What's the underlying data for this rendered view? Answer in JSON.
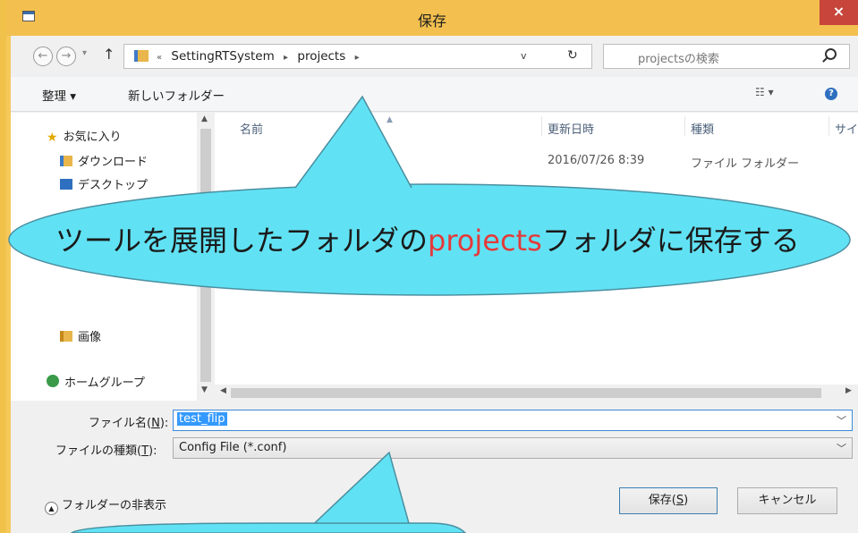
{
  "window": {
    "title": "保存",
    "close_glyph": "×"
  },
  "nav": {
    "back_glyph": "←",
    "forward_glyph": "→",
    "recent_glyph": "▾",
    "up_glyph": "↑",
    "breadcrumb": [
      "«",
      "SettingRTSystem",
      "▸",
      "projects",
      "▸"
    ],
    "address_dropdown_glyph": "v",
    "refresh_glyph": "↻",
    "search_placeholder": "projectsの検索"
  },
  "commands": {
    "organize": "整理 ▾",
    "new_folder": "新しいフォルダー",
    "view": "☷ ▾",
    "help": "?"
  },
  "sidebar": {
    "favorites": "お気に入り",
    "favorites_icon": "star-icon",
    "downloads": "ダウンロード",
    "desktop": "デスクトップ",
    "pictures": "画像",
    "homegroup": "ホームグループ"
  },
  "columns": {
    "name": "名前",
    "date": "更新日時",
    "type": "種類",
    "size": "サイズ"
  },
  "rows": [
    {
      "date": "2016/07/26 8:39",
      "type": "ファイル フォルダー"
    }
  ],
  "form": {
    "file_name_label_pre": "ファイル名(",
    "file_name_label_key": "N",
    "file_name_label_post": "):",
    "file_name_value": "test_flip",
    "file_type_label_pre": "ファイルの種類(",
    "file_type_label_key": "T",
    "file_type_label_post": "):",
    "file_type_value": "Config File (*.conf)",
    "hide_folders": "フォルダーの非表示",
    "save_pre": "保存(",
    "save_key": "S",
    "save_post": ")",
    "cancel": "キャンセル"
  },
  "callout": {
    "text_before": "ツールを展開したフォルダの",
    "text_highlight": "projects",
    "text_after": "フォルダに保存する",
    "highlight_color": "#e43a3a",
    "fill_color": "#61e2f4"
  },
  "colors": {
    "title_bar": "#f3c04f",
    "close_button": "#c7453a",
    "selection": "#3399ff"
  }
}
